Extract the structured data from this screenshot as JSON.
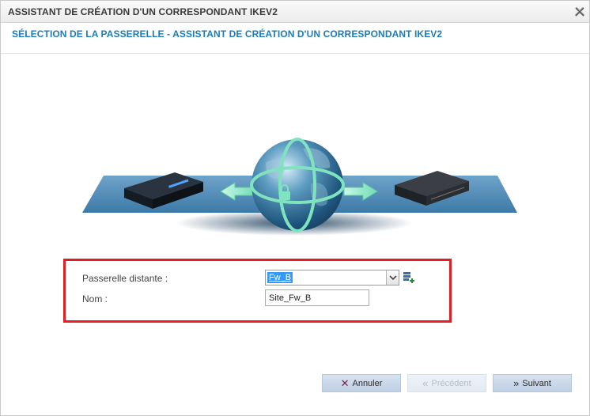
{
  "window": {
    "title": "ASSISTANT DE CRÉATION D'UN CORRESPONDANT IKEV2",
    "close_icon": "close-icon"
  },
  "step": {
    "title": "SÉLECTION DE LA PASSERELLE - ASSISTANT DE CRÉATION D'UN CORRESPONDANT IKEV2"
  },
  "illustration": {
    "description_icons": [
      "firewall-appliance-icon",
      "globe-lock-icon",
      "router-appliance-icon"
    ],
    "globe_color": "#2f6f96",
    "arrow_color": "#7fe3bf",
    "plane_color": "#5a8fb8"
  },
  "form": {
    "remote_gateway_label": "Passerelle distante :",
    "remote_gateway_value": "Fw_B",
    "name_label": "Nom :",
    "name_value": "Site_Fw_B",
    "highlight_color": "#e02020"
  },
  "buttons": {
    "cancel_label": "Annuler",
    "previous_label": "Précédent",
    "next_label": "Suivant"
  }
}
